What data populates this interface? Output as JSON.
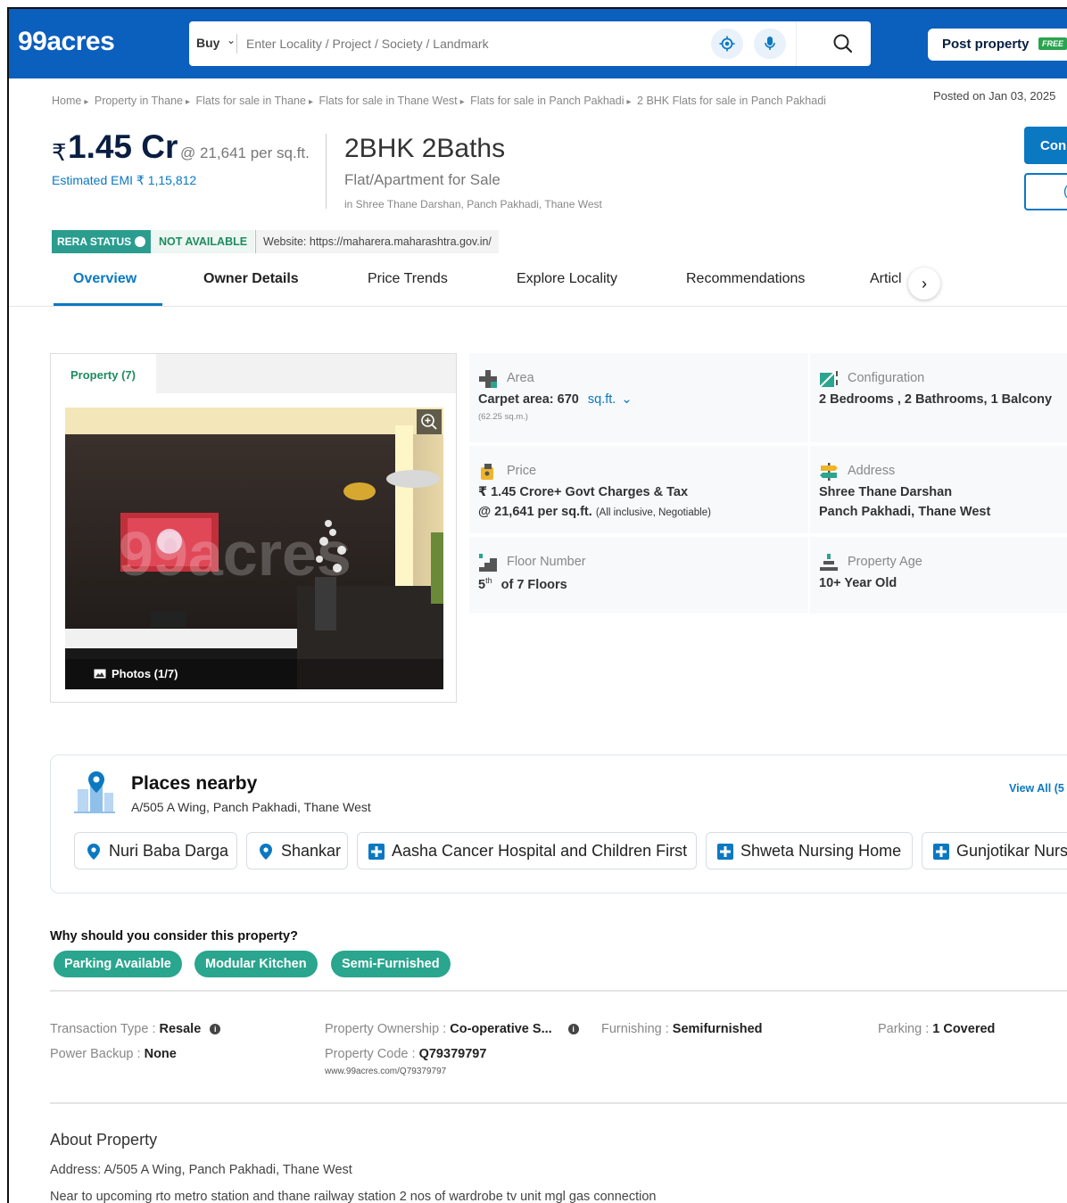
{
  "header": {
    "logo": "99acres",
    "search": {
      "mode": "Buy",
      "placeholder": "Enter Locality / Project / Society / Landmark"
    },
    "post_property": "Post property",
    "free_badge": "FREE"
  },
  "breadcrumb": [
    "Home",
    "Property in Thane",
    "Flats for sale in Thane",
    "Flats for sale in Thane West",
    "Flats for sale in Panch Pakhadi",
    "2 BHK Flats for sale in Panch Pakhadi"
  ],
  "posted_on": "Posted on Jan 03, 2025",
  "price": {
    "currency": "₹",
    "amount": "1.45 Cr",
    "per_sqft": "@ 21,641 per sq.ft.",
    "emi": "Estimated EMI ₹ 1,15,812"
  },
  "property": {
    "title": "2BHK 2Baths",
    "type": "Flat/Apartment for Sale",
    "location": "in Shree Thane Darshan, Panch Pakhadi, Thane West"
  },
  "contact": {
    "primary_label": "Con",
    "secondary_label": "("
  },
  "rera": {
    "status_label": "RERA STATUS",
    "status_value": "NOT AVAILABLE",
    "website": "Website: https://maharera.maharashtra.gov.in/"
  },
  "tabs": [
    {
      "label": "Overview",
      "active": true
    },
    {
      "label": "Owner Details"
    },
    {
      "label": "Price Trends"
    },
    {
      "label": "Explore Locality"
    },
    {
      "label": "Recommendations"
    },
    {
      "label": "Articl"
    }
  ],
  "gallery": {
    "tab_label": "Property (7)",
    "photo_count": "Photos (1/7)",
    "watermark": "99acres"
  },
  "details": {
    "area": {
      "label": "Area",
      "value": "Carpet area: 670",
      "unit": "sq.ft.",
      "sub": "(62.25 sq.m.)"
    },
    "configuration": {
      "label": "Configuration",
      "value": "2 Bedrooms , 2 Bathrooms, 1 Balcony"
    },
    "price": {
      "label": "Price",
      "line1": "₹ 1.45 Crore+ Govt Charges & Tax",
      "line2": "@ 21,641 per sq.ft.",
      "note": "(All inclusive, Negotiable)"
    },
    "address": {
      "label": "Address",
      "line1": "Shree Thane Darshan",
      "line2": "Panch Pakhadi, Thane West"
    },
    "floor": {
      "label": "Floor Number",
      "value": "5",
      "sup": "th",
      "rest": "of 7 Floors"
    },
    "age": {
      "label": "Property Age",
      "value": "10+ Year Old"
    }
  },
  "places": {
    "title": "Places nearby",
    "address": "A/505 A Wing, Panch Pakhadi, Thane West",
    "view_all": "View All (5",
    "items": [
      {
        "name": "Nuri Baba Darga",
        "icon": "location-pin-icon"
      },
      {
        "name": "Shankar",
        "icon": "location-pin-icon"
      },
      {
        "name": "Aasha Cancer Hospital and Children First",
        "icon": "hospital-cross-icon"
      },
      {
        "name": "Shweta Nursing Home",
        "icon": "hospital-cross-icon"
      },
      {
        "name": "Gunjotikar Nurs",
        "icon": "hospital-cross-icon"
      }
    ]
  },
  "why": {
    "title": "Why should you consider this property?",
    "tags": [
      "Parking Available",
      "Modular Kitchen",
      "Semi-Furnished"
    ]
  },
  "facts": {
    "transaction_label": "Transaction Type",
    "transaction_value": "Resale",
    "power_label": "Power Backup",
    "power_value": "None",
    "ownership_label": "Property Ownership",
    "ownership_value": "Co-operative S...",
    "code_label": "Property Code",
    "code_value": "Q79379797",
    "code_url": "www.99acres.com/Q79379797",
    "furnishing_label": "Furnishing",
    "furnishing_value": "Semifurnished",
    "parking_label": "Parking",
    "parking_value": "1 Covered"
  },
  "about": {
    "title": "About Property",
    "address": "Address: A/505 A Wing, Panch Pakhadi, Thane West",
    "description": "Near to upcoming rto metro station and thane railway station 2 nos of wardrobe tv unit mgl gas connection"
  },
  "colors": {
    "brand_blue": "#0b5fbd",
    "link_blue": "#0b78c2",
    "green": "#2aa58e"
  }
}
